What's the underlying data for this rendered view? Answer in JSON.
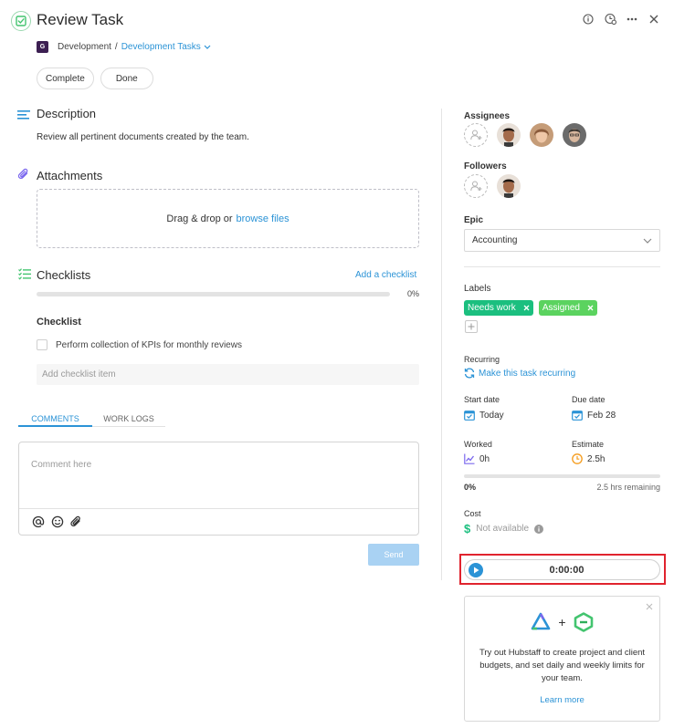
{
  "header": {
    "title": "Review Task",
    "project_initial": "G",
    "project": "Development",
    "separator": "/",
    "list": "Development Tasks",
    "colors": {
      "accent": "#2b93d6",
      "green": "#43c46f",
      "project_badge": "#3c1f52"
    }
  },
  "status_buttons": [
    {
      "label": "Complete"
    },
    {
      "label": "Done"
    }
  ],
  "description": {
    "heading": "Description",
    "text": "Review all pertinent documents created by the team."
  },
  "attachments": {
    "heading": "Attachments",
    "drop_text": "Drag & drop or",
    "browse_link": "browse files"
  },
  "checklists": {
    "heading": "Checklists",
    "add_link": "Add a checklist",
    "progress_percent": 0,
    "progress_label": "0%",
    "checklist_title": "Checklist",
    "items": [
      {
        "text": "Perform collection of KPIs for monthly reviews",
        "checked": false
      }
    ],
    "add_item_placeholder": "Add checklist item"
  },
  "tabs": [
    {
      "label": "COMMENTS",
      "active": true
    },
    {
      "label": "WORK LOGS",
      "active": false
    }
  ],
  "comment": {
    "placeholder": "Comment here",
    "send_label": "Send"
  },
  "sidebar": {
    "assignees_label": "Assignees",
    "followers_label": "Followers",
    "epic_label": "Epic",
    "epic_value": "Accounting",
    "labels_label": "Labels",
    "labels": [
      {
        "text": "Needs work",
        "color": "#1bbf7f"
      },
      {
        "text": "Assigned",
        "color": "#5bd35f"
      }
    ],
    "recurring_label": "Recurring",
    "recurring_link": "Make this task recurring",
    "start_date_label": "Start date",
    "start_date_value": "Today",
    "due_date_label": "Due date",
    "due_date_value": "Feb 28",
    "worked_label": "Worked",
    "worked_value": "0h",
    "estimate_label": "Estimate",
    "estimate_value": "2.5h",
    "worked_progress_percent": 0,
    "worked_progress_label": "0%",
    "remaining_label": "2.5 hrs remaining",
    "cost_label": "Cost",
    "cost_value": "Not available",
    "timer_value": "0:00:00"
  },
  "promo": {
    "plus": "+",
    "text": "Try out Hubstaff to create project and client budgets, and set daily and weekly limits for your team.",
    "link": "Learn more"
  }
}
